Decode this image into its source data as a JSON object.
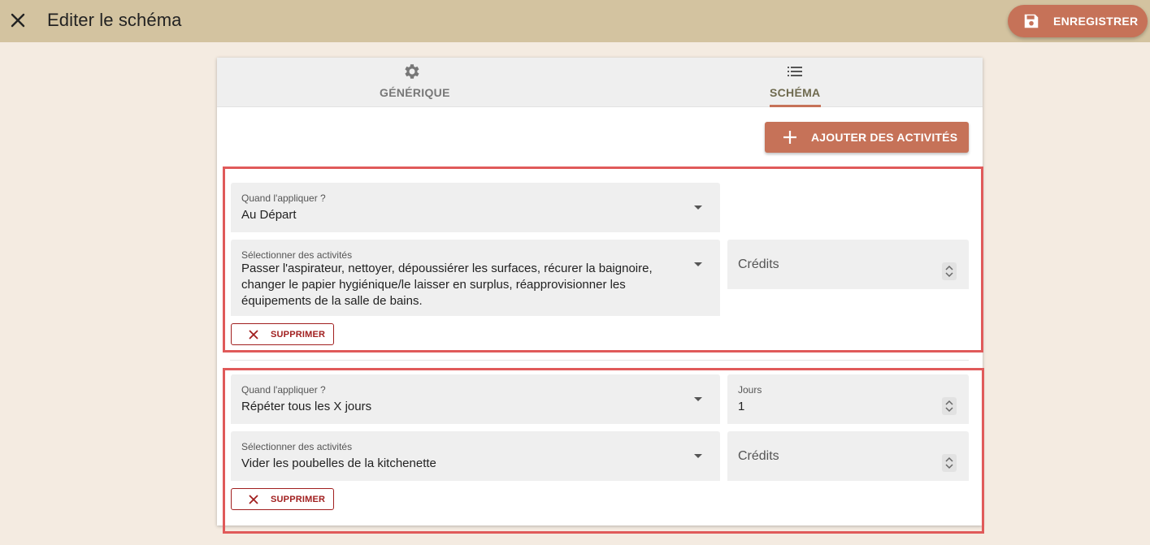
{
  "header": {
    "title": "Editer le schéma",
    "close_icon": "close-icon",
    "save_label": "ENREGISTRER",
    "save_icon": "floppy-disk-icon"
  },
  "tabs": [
    {
      "label": "GÉNÉRIQUE",
      "icon": "gear-icon",
      "active": false
    },
    {
      "label": "SCHÉMA",
      "icon": "list-icon",
      "active": true
    }
  ],
  "add_button": {
    "label": "AJOUTER DES ACTIVITÉS",
    "icon": "plus-icon"
  },
  "rules": [
    {
      "when_label": "Quand l'appliquer ?",
      "when_value": "Au Départ",
      "activities_label": "Sélectionner des activités",
      "activities_value": "Passer l'aspirateur, nettoyer, dépoussiérer les surfaces, récurer la baignoire, changer le papier hygiénique/le laisser en surplus, réapprovisionner les équipements de la salle de bains.",
      "credits_placeholder": "Crédits",
      "delete_label": "SUPPRIMER"
    },
    {
      "when_label": "Quand l'appliquer ?",
      "when_value": "Répéter tous les X jours",
      "days_label": "Jours",
      "days_value": "1",
      "activities_label": "Sélectionner des activités",
      "activities_value": "Vider les poubelles de la kitchenette",
      "credits_placeholder": "Crédits",
      "delete_label": "SUPPRIMER"
    }
  ],
  "colors": {
    "topbar": "#d3c3a0",
    "background": "#f4ebe1",
    "accent": "#c67258",
    "danger": "#a11f1f",
    "highlight": "#e05a5a"
  }
}
